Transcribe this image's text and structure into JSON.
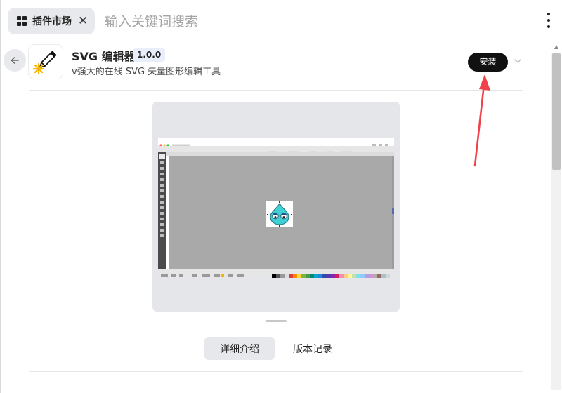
{
  "topbar": {
    "tab_label": "插件市场",
    "close_glyph": "✕",
    "search_placeholder": "输入关键词搜索"
  },
  "plugin": {
    "name": "SVG 编辑器",
    "version": "1.0.0",
    "description": "v强大的在线 SVG 矢量图形编辑工具",
    "install_label": "安装"
  },
  "tabs": [
    {
      "label": "详细介绍",
      "active": true
    },
    {
      "label": "版本记录",
      "active": false
    }
  ],
  "colors": {
    "install_bg": "#111111",
    "annotation_arrow": "#f0424a"
  },
  "icons": {
    "tab": "grid-icon",
    "back": "arrow-left-icon",
    "app": "pencil-sparkle-icon",
    "more": "chevron-down-icon",
    "menu": "kebab-menu-icon"
  }
}
